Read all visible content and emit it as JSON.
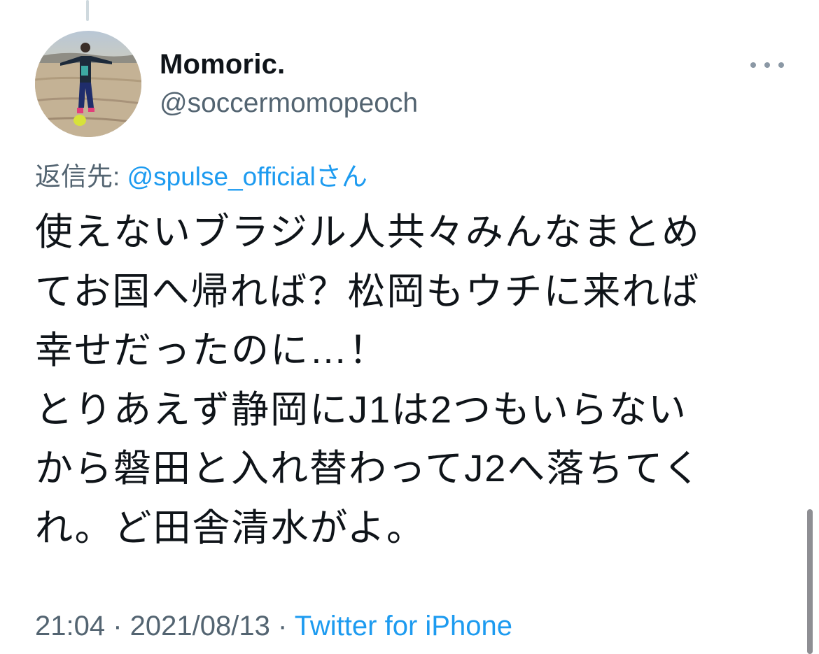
{
  "user": {
    "display_name": "Momoric.",
    "handle": "@soccermomopeoch"
  },
  "reply": {
    "prefix": "返信先: ",
    "target": "@spulse_official",
    "suffix": "さん"
  },
  "tweet": {
    "lines": [
      "使えないブラジル人共々みんなまとめ",
      "てお国へ帰れば？松岡もウチに来れば",
      "幸せだったのに…！",
      "とりあえず静岡にJ1は2つもいらない",
      "から磐田と入れ替わってJ2へ落ちてく",
      "れ。ど田舎清水がよ。"
    ]
  },
  "meta": {
    "time": "21:04",
    "separator": " · ",
    "date": "2021/08/13",
    "source": "Twitter for iPhone"
  },
  "icons": {
    "more": "more-horizontal-icon",
    "avatar": "profile-photo"
  },
  "colors": {
    "link": "#1d9bf0",
    "secondary_text": "#536471",
    "primary_text": "#0f1419"
  }
}
